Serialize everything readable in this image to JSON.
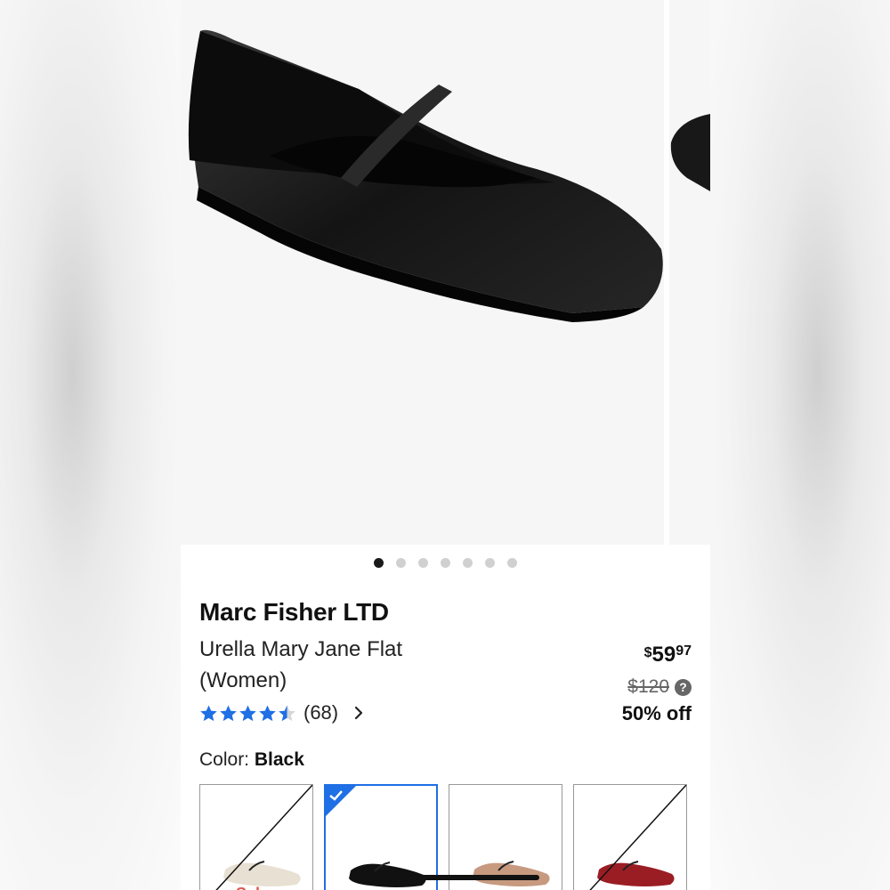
{
  "gallery": {
    "dot_count": 7,
    "active_index": 0
  },
  "product": {
    "brand": "Marc Fisher LTD",
    "name_line1": "Urella Mary Jane Flat",
    "name_line2": "(Women)",
    "rating_value": 4.5,
    "rating_max": 5,
    "review_count": "(68)"
  },
  "price": {
    "dollar_sign": "$",
    "whole": "59",
    "cents": "97",
    "was": "$120",
    "help_glyph": "?",
    "discount": "50% off"
  },
  "color": {
    "label": "Color:",
    "value": "Black",
    "swatches": [
      {
        "name": "cream",
        "sale_label": "Sale",
        "unavailable": true,
        "selected": false,
        "color": "#e8e0d2"
      },
      {
        "name": "black",
        "sale_label": "",
        "unavailable": false,
        "selected": true,
        "color": "#111111"
      },
      {
        "name": "tan",
        "sale_label": "",
        "unavailable": false,
        "selected": false,
        "color": "#c79a80"
      },
      {
        "name": "red",
        "sale_label": "",
        "unavailable": true,
        "selected": false,
        "color": "#9b1d24"
      }
    ]
  },
  "colors": {
    "star": "#1f6fe5",
    "accent": "#1f6fe5"
  }
}
